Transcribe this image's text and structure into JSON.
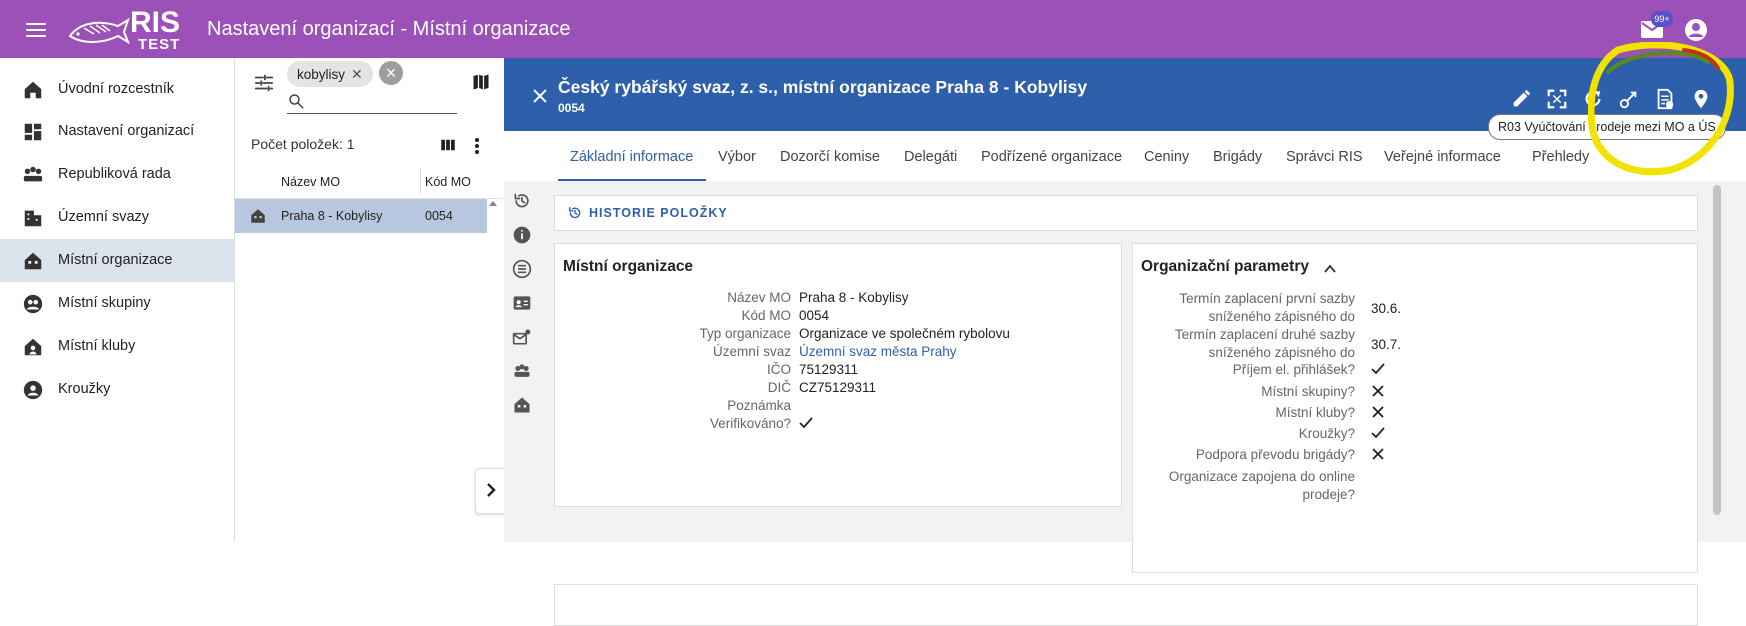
{
  "app": {
    "logo_text": "RIS",
    "logo_sub": "TEST",
    "title": "Nastavení organizací - Místní organizace",
    "mail_badge": "99+",
    "colors": {
      "topbar": "#9c51b9",
      "detail_header": "#2e5fab",
      "selected_row": "#b7c7e0",
      "highlight": "#f5e600"
    }
  },
  "sidebar": {
    "items": [
      {
        "label": "Úvodní rozcestník",
        "icon": "home-icon"
      },
      {
        "label": "Nastavení organizací",
        "icon": "dashboard-icon"
      },
      {
        "label": "Republiková rada",
        "icon": "groups-icon"
      },
      {
        "label": "Územní svazy",
        "icon": "building-icon"
      },
      {
        "label": "Místní organizace",
        "icon": "house-icon",
        "active": true
      },
      {
        "label": "Místní skupiny",
        "icon": "people-icon"
      },
      {
        "label": "Místní kluby",
        "icon": "club-icon"
      },
      {
        "label": "Kroužky",
        "icon": "circle-person-icon"
      }
    ]
  },
  "list": {
    "filter_chip": "kobylisy",
    "search_placeholder": "",
    "count_label": "Počet položek: 1",
    "columns": [
      "Název MO",
      "Kód MO"
    ],
    "rows": [
      {
        "name": "Praha 8 - Kobylisy",
        "code": "0054"
      }
    ]
  },
  "detail": {
    "title": "Český rybářský svaz, z. s., místní organizace Praha 8 - Kobylisy",
    "subtitle": "0054",
    "tooltip": "R03 Vyúčtování prodeje mezi MO a ÚS",
    "tabs": [
      "Základní informace",
      "Výbor",
      "Dozorčí komise",
      "Delegáti",
      "Podřízené organizace",
      "Ceniny",
      "Brigády",
      "Správci RIS",
      "Veřejné informace",
      "Přehledy"
    ],
    "active_tab": 0,
    "history_label": "HISTORIE POLOŽKY",
    "mo_card": {
      "title": "Místní organizace",
      "fields": [
        {
          "label": "Název MO",
          "value": "Praha 8 - Kobylisy"
        },
        {
          "label": "Kód MO",
          "value": "0054"
        },
        {
          "label": "Typ organizace",
          "value": "Organizace ve společném rybolovu"
        },
        {
          "label": "Územní svaz",
          "value": "Územní svaz města Prahy",
          "link": true
        },
        {
          "label": "IČO",
          "value": "75129311"
        },
        {
          "label": "DIČ",
          "value": "CZ75129311"
        },
        {
          "label": "Poznámka",
          "value": ""
        },
        {
          "label": "Verifikováno?",
          "check": "check"
        }
      ]
    },
    "org_card": {
      "title": "Organizační parametry",
      "fields": [
        {
          "label": "Termín zaplacení první sazby sníženého zápisného do",
          "value": "30.6."
        },
        {
          "label": "Termín zaplacení druhé sazby sníženého zápisného do",
          "value": "30.7."
        },
        {
          "label": "Příjem el. přihlášek?",
          "check": "check"
        },
        {
          "label": "Místní skupiny?",
          "check": "cross"
        },
        {
          "label": "Místní kluby?",
          "check": "cross"
        },
        {
          "label": "Kroužky?",
          "check": "check"
        },
        {
          "label": "Podpora převodu brigády?",
          "check": "cross"
        },
        {
          "label": "Organizace zapojena do online prodeje?",
          "check": ""
        }
      ]
    }
  }
}
